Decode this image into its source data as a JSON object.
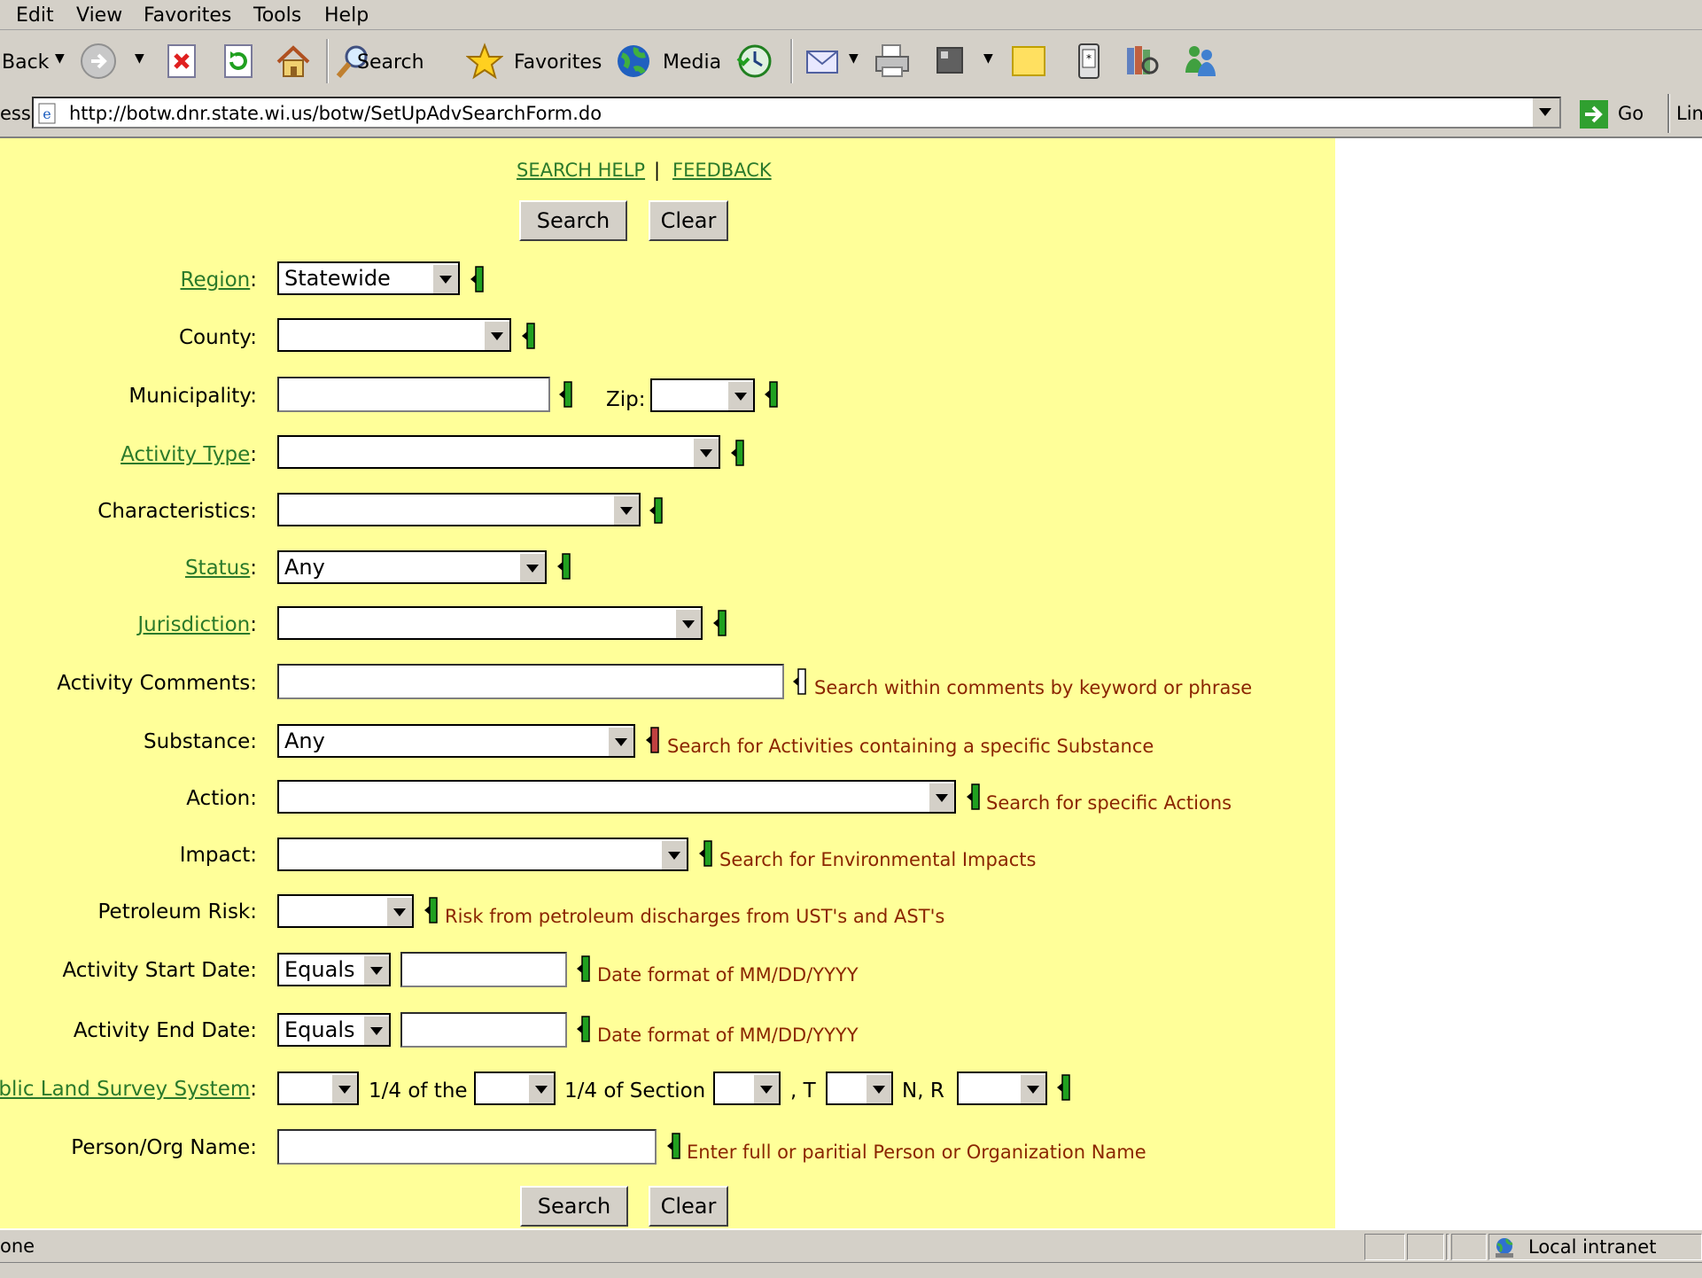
{
  "menu": [
    "Edit",
    "View",
    "Favorites",
    "Tools",
    "Help"
  ],
  "toolbar": {
    "back": "Back",
    "search": "Search",
    "favorites": "Favorites",
    "media": "Media"
  },
  "address": {
    "label": "ess",
    "url": "http://botw.dnr.state.wi.us/botw/SetUpAdvSearchForm.do",
    "go": "Go",
    "links": "Lin"
  },
  "top_links": {
    "search_help": "SEARCH HELP",
    "separator": "|",
    "feedback": "FEEDBACK"
  },
  "buttons": {
    "search": "Search",
    "clear": "Clear"
  },
  "form": {
    "region": {
      "label": "Region",
      "colon": ":",
      "value": "Statewide"
    },
    "county": {
      "label": "County:",
      "value": ""
    },
    "municipality": {
      "label": "Municipality:",
      "zip_label": "Zip:"
    },
    "activity_type": {
      "label": "Activity Type",
      "colon": ":"
    },
    "characteristics": {
      "label": "Characteristics:"
    },
    "status": {
      "label": "Status",
      "colon": ":",
      "value": "Any"
    },
    "jurisdiction": {
      "label": "Jurisdiction",
      "colon": ":"
    },
    "activity_comments": {
      "label": "Activity Comments:",
      "hint": "Search within comments by keyword or phrase"
    },
    "substance": {
      "label": "Substance:",
      "value": "Any",
      "hint": "Search for Activities containing a specific Substance"
    },
    "action": {
      "label": "Action:",
      "hint": "Search for specific Actions"
    },
    "impact": {
      "label": "Impact:",
      "hint": "Search for Environmental Impacts"
    },
    "petroleum_risk": {
      "label": "Petroleum Risk:",
      "hint": "Risk from petroleum discharges from UST's and AST's"
    },
    "activity_start_date": {
      "label": "Activity Start Date:",
      "operator": "Equals",
      "hint": "Date format of MM/DD/YYYY"
    },
    "activity_end_date": {
      "label": "Activity End Date:",
      "operator": "Equals",
      "hint": "Date format of MM/DD/YYYY"
    },
    "plss": {
      "label": "Public Land Survey System",
      "colon": ":",
      "t1": "1/4 of the",
      "t2": "1/4 of Section",
      "t3": ", T",
      "t4": "N, R"
    },
    "person_org": {
      "label": "Person/Org Name:",
      "hint": "Enter full or paritial Person or Organization Name"
    }
  },
  "statusbar": {
    "left": "one",
    "zone": "Local intranet"
  }
}
